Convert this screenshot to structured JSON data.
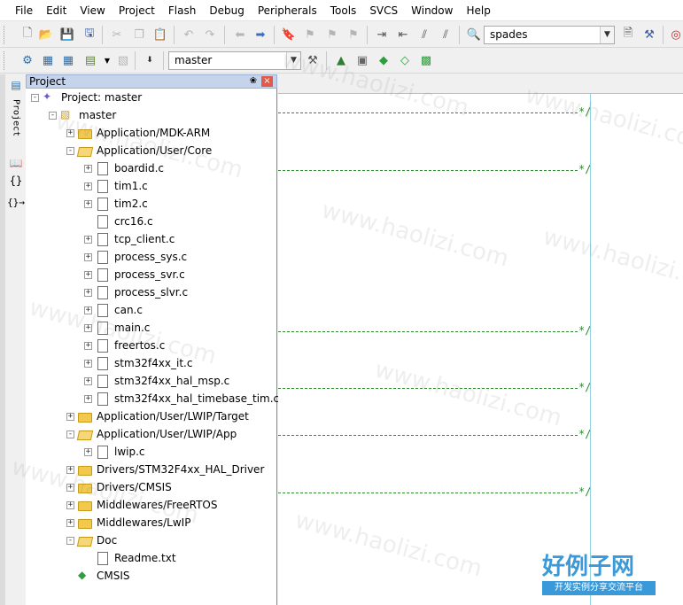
{
  "menu": [
    "File",
    "Edit",
    "View",
    "Project",
    "Flash",
    "Debug",
    "Peripherals",
    "Tools",
    "SVCS",
    "Window",
    "Help"
  ],
  "toolbar1": {
    "find_combo_value": "spades"
  },
  "toolbar2": {
    "target_combo_value": "master"
  },
  "side_tab_label": "Project",
  "project_panel": {
    "title": "Project",
    "pin_glyph": "❀",
    "close_glyph": "×"
  },
  "tree": [
    {
      "label": "Project: master",
      "level": 0,
      "expander": "-",
      "icon": "project"
    },
    {
      "label": "master",
      "level": 1,
      "expander": "-",
      "icon": "target"
    },
    {
      "label": "Application/MDK-ARM",
      "level": 2,
      "expander": "+",
      "icon": "folder"
    },
    {
      "label": "Application/User/Core",
      "level": 2,
      "expander": "-",
      "icon": "folder-open"
    },
    {
      "label": "boardid.c",
      "level": 3,
      "expander": "+",
      "icon": "file"
    },
    {
      "label": "tim1.c",
      "level": 3,
      "expander": "+",
      "icon": "file"
    },
    {
      "label": "tim2.c",
      "level": 3,
      "expander": "+",
      "icon": "file"
    },
    {
      "label": "crc16.c",
      "level": 3,
      "expander": "",
      "icon": "file"
    },
    {
      "label": "tcp_client.c",
      "level": 3,
      "expander": "+",
      "icon": "file"
    },
    {
      "label": "process_sys.c",
      "level": 3,
      "expander": "+",
      "icon": "file"
    },
    {
      "label": "process_svr.c",
      "level": 3,
      "expander": "+",
      "icon": "file"
    },
    {
      "label": "process_slvr.c",
      "level": 3,
      "expander": "+",
      "icon": "file"
    },
    {
      "label": "can.c",
      "level": 3,
      "expander": "+",
      "icon": "file"
    },
    {
      "label": "main.c",
      "level": 3,
      "expander": "+",
      "icon": "file"
    },
    {
      "label": "freertos.c",
      "level": 3,
      "expander": "+",
      "icon": "file"
    },
    {
      "label": "stm32f4xx_it.c",
      "level": 3,
      "expander": "+",
      "icon": "file"
    },
    {
      "label": "stm32f4xx_hal_msp.c",
      "level": 3,
      "expander": "+",
      "icon": "file"
    },
    {
      "label": "stm32f4xx_hal_timebase_tim.c",
      "level": 3,
      "expander": "+",
      "icon": "file"
    },
    {
      "label": "Application/User/LWIP/Target",
      "level": 2,
      "expander": "+",
      "icon": "folder"
    },
    {
      "label": "Application/User/LWIP/App",
      "level": 2,
      "expander": "-",
      "icon": "folder-open"
    },
    {
      "label": "lwip.c",
      "level": 3,
      "expander": "+",
      "icon": "file"
    },
    {
      "label": "Drivers/STM32F4xx_HAL_Driver",
      "level": 2,
      "expander": "+",
      "icon": "folder"
    },
    {
      "label": "Drivers/CMSIS",
      "level": 2,
      "expander": "+",
      "icon": "folder"
    },
    {
      "label": "Middlewares/FreeRTOS",
      "level": 2,
      "expander": "+",
      "icon": "folder"
    },
    {
      "label": "Middlewares/LwIP",
      "level": 2,
      "expander": "+",
      "icon": "folder"
    },
    {
      "label": "Doc",
      "level": 2,
      "expander": "-",
      "icon": "folder-open"
    },
    {
      "label": "Readme.txt",
      "level": 3,
      "expander": "",
      "icon": "file"
    },
    {
      "label": "CMSIS",
      "level": 2,
      "expander": "",
      "icon": "cmsis"
    }
  ],
  "editor": {
    "comment_end": "*/"
  },
  "watermark": {
    "text": "www.haolizi.com",
    "logo_title": "好例子网",
    "logo_subtitle": "开发实例分享交流平台"
  }
}
